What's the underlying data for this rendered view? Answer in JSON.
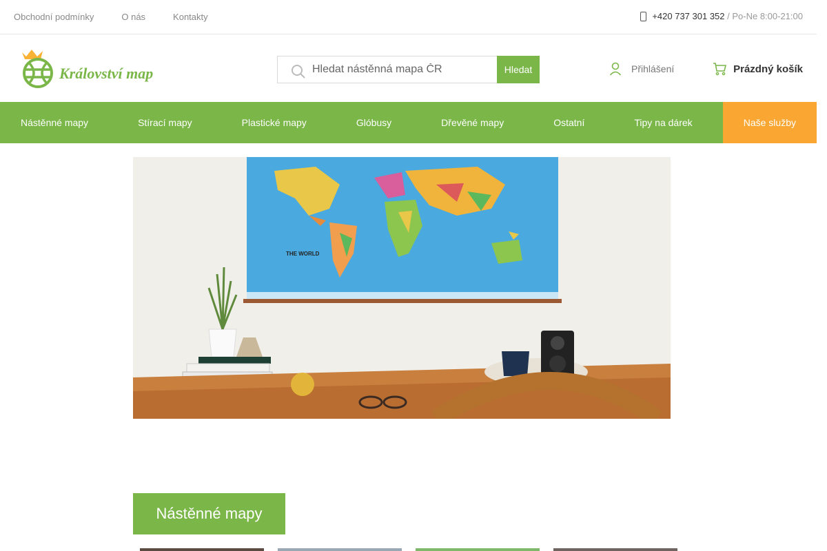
{
  "topbar": {
    "links": [
      "Obchodní podmínky",
      "O nás",
      "Kontakty"
    ],
    "phone": "+420 737 301 352",
    "hours": "/ Po-Ne 8:00-21:00"
  },
  "header": {
    "logo_text": "Království map",
    "search_placeholder": "Hledat nástěnná mapa ČR",
    "search_button": "Hledat",
    "login_label": "Přihlášení",
    "cart_label": "Prázdný košík"
  },
  "nav": {
    "items": [
      "Nástěnné mapy",
      "Stírací mapy",
      "Plastické mapy",
      "Glóbusy",
      "Dřevěné mapy",
      "Ostatní",
      "Tipy na dárek"
    ],
    "active_item": "Naše služby"
  },
  "hero": {
    "map_title": "THE WORLD"
  },
  "section": {
    "title": "Nástěnné mapy"
  },
  "colors": {
    "brand_green": "#7ab648",
    "accent_orange": "#f9a732"
  }
}
